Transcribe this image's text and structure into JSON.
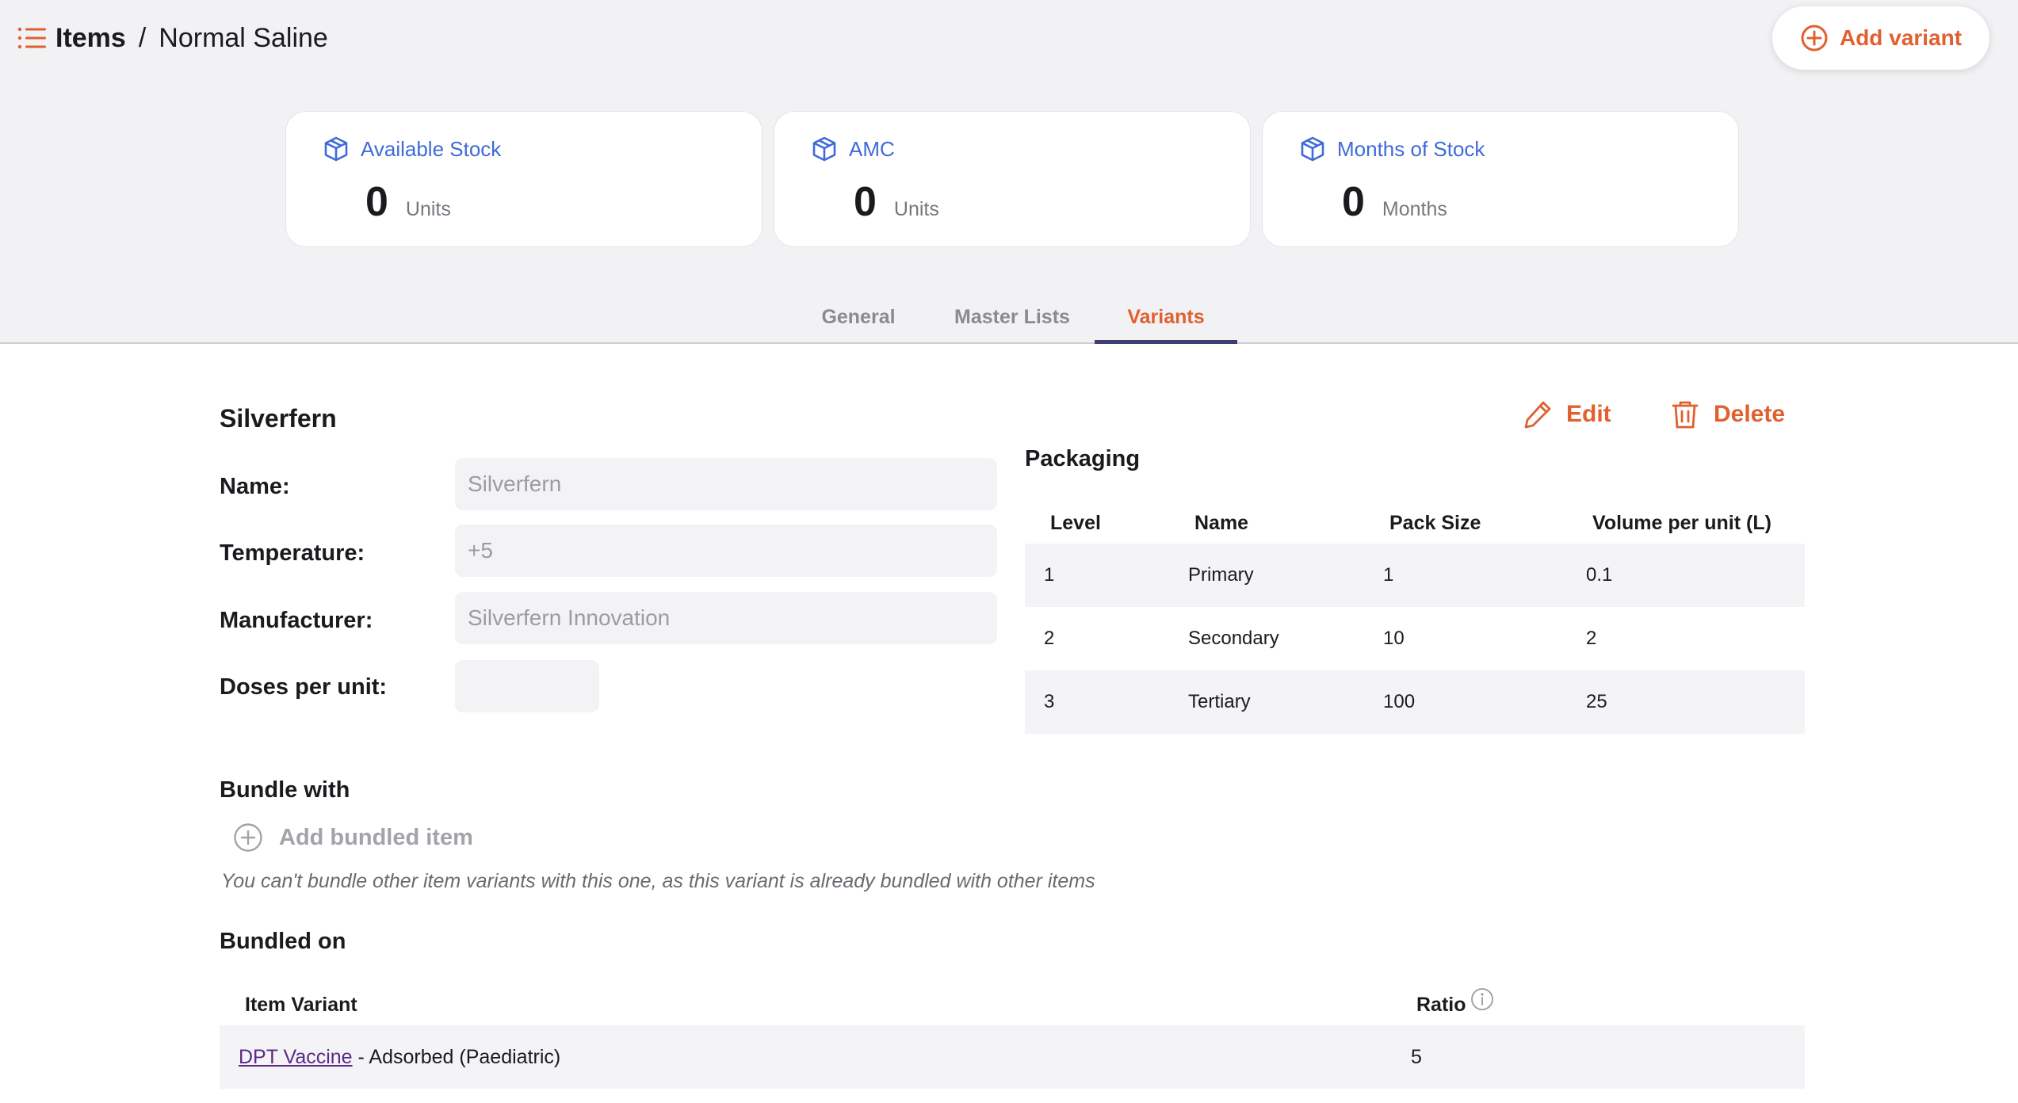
{
  "header": {
    "breadcrumb_root": "Items",
    "breadcrumb_separator": "/",
    "breadcrumb_current": "Normal Saline",
    "add_variant_label": "Add variant"
  },
  "stats": [
    {
      "label": "Available Stock",
      "value": "0",
      "unit": "Units"
    },
    {
      "label": "AMC",
      "value": "0",
      "unit": "Units"
    },
    {
      "label": "Months of Stock",
      "value": "0",
      "unit": "Months"
    }
  ],
  "tabs": [
    {
      "label": "General",
      "active": false
    },
    {
      "label": "Master Lists",
      "active": false
    },
    {
      "label": "Variants",
      "active": true
    }
  ],
  "variant": {
    "title": "Silverfern",
    "edit_label": "Edit",
    "delete_label": "Delete",
    "fields": [
      {
        "label": "Name:",
        "value": "Silverfern"
      },
      {
        "label": "Temperature:",
        "value": "+5"
      },
      {
        "label": "Manufacturer:",
        "value": "Silverfern Innovation"
      },
      {
        "label": "Doses per unit:",
        "value": ""
      }
    ]
  },
  "packaging": {
    "title": "Packaging",
    "columns": [
      "Level",
      "Name",
      "Pack Size",
      "Volume per unit (L)"
    ],
    "rows": [
      [
        "1",
        "Primary",
        "1",
        "0.1"
      ],
      [
        "2",
        "Secondary",
        "10",
        "2"
      ],
      [
        "3",
        "Tertiary",
        "100",
        "25"
      ]
    ]
  },
  "bundle_with": {
    "title": "Bundle with",
    "add_label": "Add bundled item",
    "note": "You can't bundle other item variants with this one, as this variant is already bundled with other items"
  },
  "bundled_on": {
    "title": "Bundled on",
    "columns": [
      "Item Variant",
      "Ratio"
    ],
    "rows": [
      {
        "item_link": "DPT Vaccine",
        "item_rest": " - Adsorbed (Paediatric)",
        "ratio": "5"
      }
    ]
  },
  "colors": {
    "accent": "#e0602f",
    "stat_blue": "#3f6ad8",
    "tab_underline": "#3c3e70",
    "link_purple": "#5b2a86"
  }
}
